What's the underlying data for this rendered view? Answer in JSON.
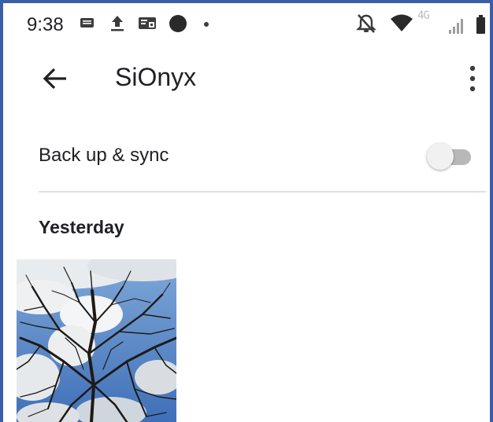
{
  "status_bar": {
    "time": "9:38",
    "icons": [
      "message-icon",
      "upload-icon",
      "cast-icon",
      "circle-icon",
      "dot-icon",
      "bell-off-icon",
      "wifi-icon",
      "network-4g-icon",
      "signal-icon",
      "battery-icon"
    ],
    "network": "4G"
  },
  "toolbar": {
    "title": "SiOnyx",
    "back_icon": "arrow-back-icon",
    "menu_icon": "more-vert-icon"
  },
  "sync": {
    "label": "Back up & sync",
    "enabled": false
  },
  "sections": [
    {
      "header": "Yesterday",
      "photos": [
        {
          "subject": "bare tree branches against blue sky with clouds"
        }
      ]
    }
  ],
  "colors": {
    "accent_border": "#3b5fa7",
    "toggle_track_off": "#b8b8b8",
    "toggle_thumb_off": "#f1f1f1",
    "divider": "#e0e0e0"
  }
}
